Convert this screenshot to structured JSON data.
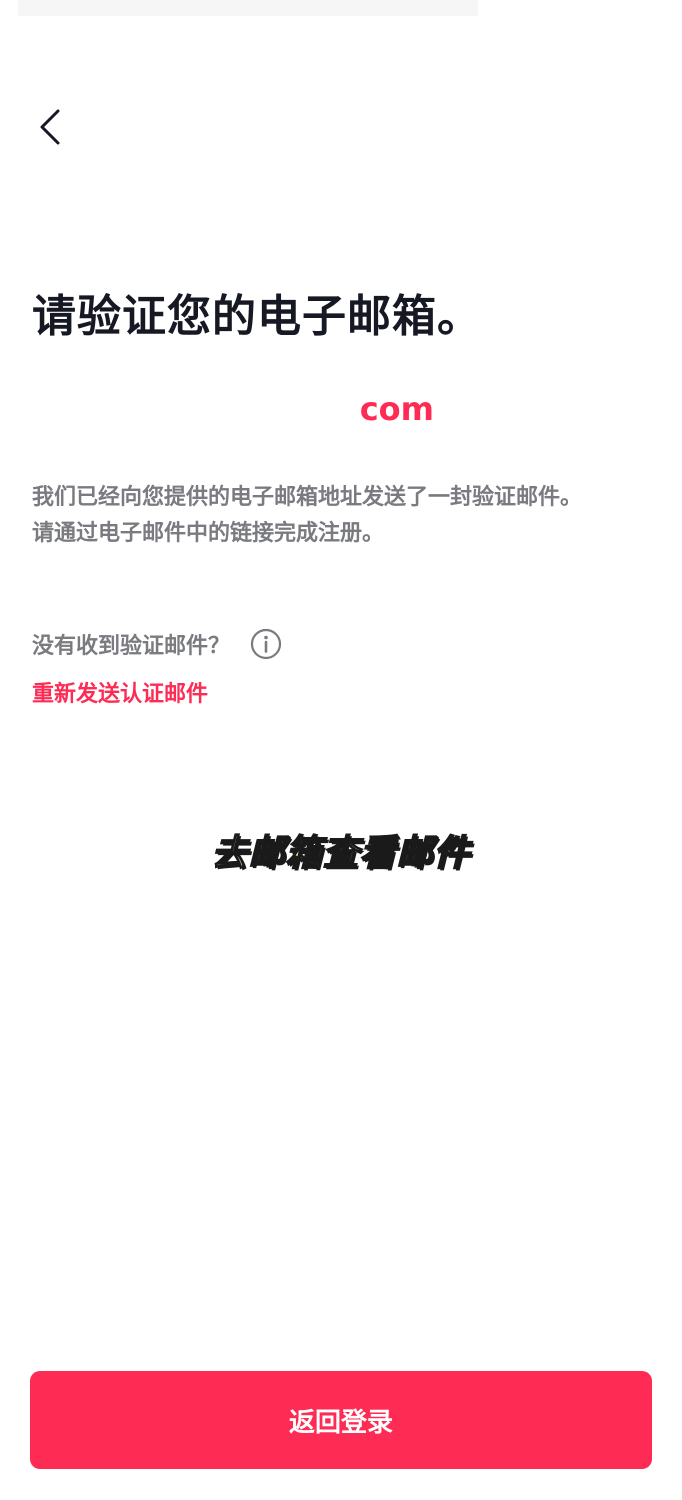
{
  "header": {
    "back_icon": "chevron-left-icon"
  },
  "main": {
    "title": "请验证您的电子邮箱。",
    "email": "com",
    "description_line1": "我们已经向您提供的电子邮箱地址发送了一封验证邮件。",
    "description_line2": "请通过电子邮件中的链接完成注册。",
    "no_email_question": "没有收到验证邮件？",
    "info_icon": "info-icon",
    "resend_label": "重新发送认证邮件"
  },
  "overlay": {
    "caption": "去邮箱查看邮件"
  },
  "footer": {
    "back_to_login_label": "返回登录"
  },
  "colors": {
    "accent": "#fe2c55",
    "title_text": "#161823",
    "secondary_text": "#7a7b80",
    "caption_fill": "#fff59d"
  }
}
